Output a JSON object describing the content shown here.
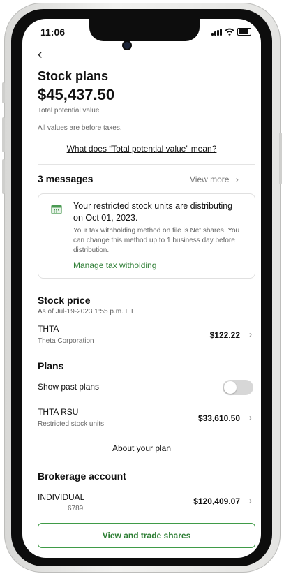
{
  "status": {
    "time": "11:06"
  },
  "header": {
    "back_label": "‹",
    "title": "Stock plans",
    "total_value": "$45,437.50",
    "total_caption": "Total potential value",
    "note": "All values are before taxes.",
    "info_link": "What does “Total potential value” mean?"
  },
  "messages": {
    "heading": "3 messages",
    "view_more": "View more",
    "card": {
      "title": "Your restricted stock units are distributing on Oct 01, 2023.",
      "body": "Your tax withholding method on file is Net shares. You can change this method up to 1 business day before distribution.",
      "action": "Manage tax witholding"
    }
  },
  "stock_price": {
    "heading": "Stock price",
    "as_of": "As of Jul-19-2023 1:55 p.m. ET",
    "ticker": "THTA",
    "company": "Theta Corporation",
    "price": "$122.22"
  },
  "plans": {
    "heading": "Plans",
    "toggle_label": "Show past plans",
    "toggle_on": false,
    "plan_name": "THTA RSU",
    "plan_type": "Restricted stock units",
    "plan_value": "$33,610.50",
    "about_link": "About your plan"
  },
  "brokerage": {
    "heading": "Brokerage account",
    "account_type": "INDIVIDUAL",
    "account_number": "6789",
    "account_value": "$120,409.07",
    "cta": "View and trade shares"
  },
  "icons": {
    "chevron": "›",
    "calendar": "calendar-icon"
  },
  "colors": {
    "accent_green": "#2f7f36",
    "icon_green": "#4a9a52"
  }
}
